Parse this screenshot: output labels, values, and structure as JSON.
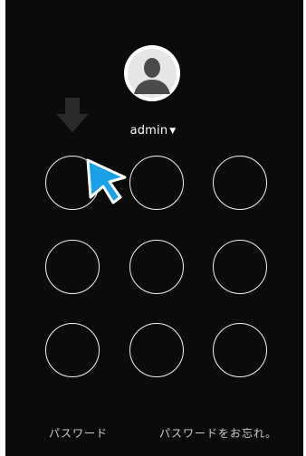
{
  "user": {
    "name": "admin",
    "dropdown_icon": "caret-down-icon"
  },
  "icons": {
    "avatar": "default-user-avatar-icon",
    "hint_arrow": "down-arrow-icon",
    "cursor": "mouse-pointer-icon"
  },
  "pattern_grid": {
    "rows": 3,
    "cols": 3
  },
  "footer": {
    "password_link": "パスワード",
    "forgot_password_link": "パスワードをお忘れ。"
  },
  "colors": {
    "background": "#0b0b0b",
    "dot_outline": "#f2f2f2",
    "cursor_fill": "#1aa0e6",
    "hint_arrow": "#2a2a2a"
  }
}
